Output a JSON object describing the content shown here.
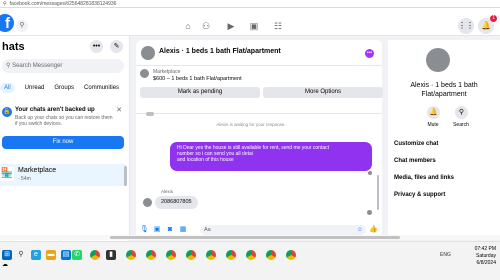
{
  "browser": {
    "url": "facebook.com/messages/t/25648281838124936"
  },
  "topnav": {
    "badge_count": "1"
  },
  "sidebar": {
    "title": "hats",
    "search_placeholder": "Search Messenger",
    "filters": [
      "All",
      "Unread",
      "Groups",
      "Communities"
    ],
    "backup": {
      "title": "Your chats aren't backed up",
      "text": "Back up your chats so you can restore them if you switch devices.",
      "button": "Fix now"
    },
    "chat": {
      "name": "Marketplace",
      "sub": "· 54m"
    }
  },
  "conversation": {
    "title": "Alexis · 1 beds 1 bath Flat/apartment",
    "listing_source": "Marketplace",
    "listing_title": "$600 – 1 beds 1 bath Flat/apartment",
    "mark_pending": "Mark as pending",
    "more_options": "More Options",
    "waiting": "Alexis is waiting for your response.",
    "outgoing_lines": [
      "Hi Dear yes the house is still available for rent, send me your contact",
      "number so i can send you all detai",
      "and location of this house"
    ],
    "sender_name": "Alexis",
    "incoming": "2086807805",
    "composer_placeholder": "Aa"
  },
  "details": {
    "name_line1": "Alexis · 1 beds 1 bath",
    "name_line2": "Flat/apartment",
    "mute": "Mute",
    "search": "Search",
    "sections": [
      "Customize chat",
      "Chat members",
      "Media, files and links",
      "Privacy & support"
    ]
  },
  "taskbar": {
    "time": "07:42 PM",
    "day": "Saturday",
    "date": "6/8/2024",
    "lang": "ENG"
  }
}
